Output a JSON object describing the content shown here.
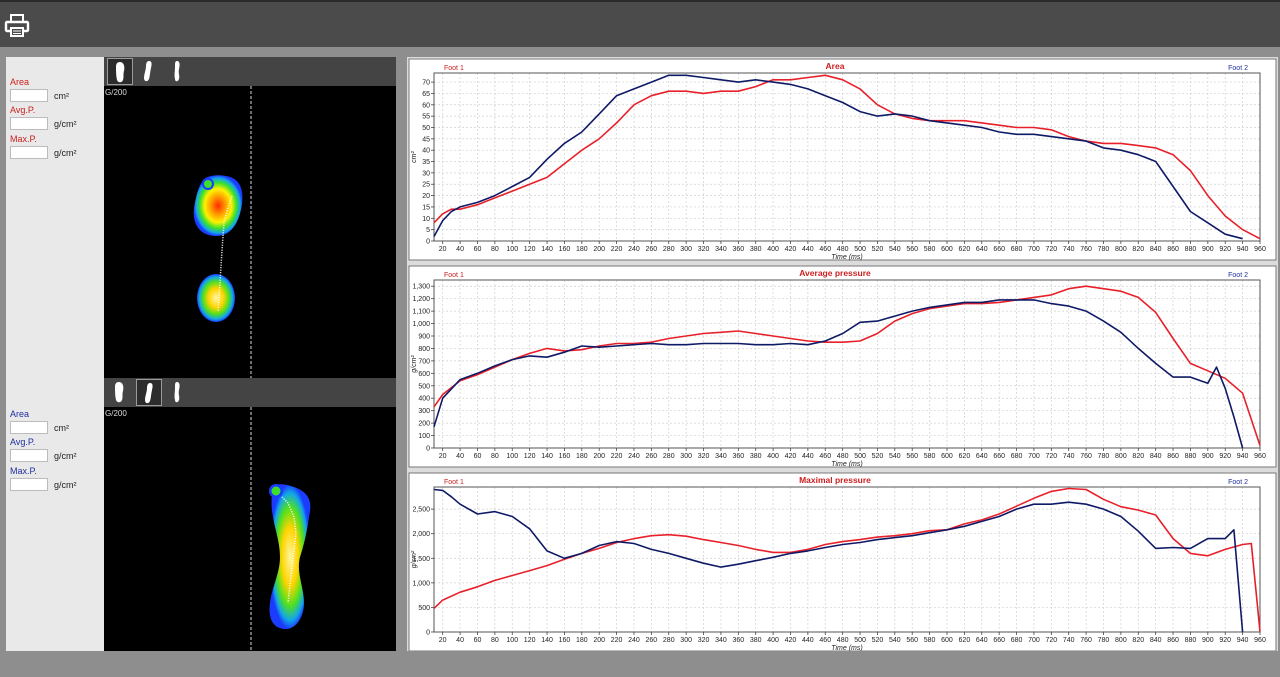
{
  "left_panel": {
    "foot1": {
      "color": "#cc2020",
      "fields": [
        {
          "label": "Area",
          "unit": "cm²",
          "value": ""
        },
        {
          "label": "Avg.P.",
          "unit": "g/cm²",
          "value": ""
        },
        {
          "label": "Max.P.",
          "unit": "g/cm²",
          "value": ""
        }
      ]
    },
    "foot2": {
      "color": "#1f2fa0",
      "fields": [
        {
          "label": "Area",
          "unit": "cm²",
          "value": ""
        },
        {
          "label": "Avg.P.",
          "unit": "g/cm²",
          "value": ""
        },
        {
          "label": "Max.P.",
          "unit": "g/cm²",
          "value": ""
        }
      ]
    }
  },
  "foot_views": [
    {
      "scale_label": "G/200",
      "active_button": 0
    },
    {
      "scale_label": "G/200",
      "active_button": 1
    }
  ],
  "icons": [
    "printer-icon",
    "foot-left-icon",
    "foot-right-icon",
    "foot-both-icon"
  ],
  "colors": {
    "foot1": "#e8202a",
    "foot2": "#0f1a66",
    "foot1_label": "#cc2020",
    "foot2_label": "#1f2fa0"
  },
  "chart_data": [
    {
      "type": "line",
      "title": "Area",
      "xlabel": "Time (ms)",
      "ylabel": "cm²",
      "legend_left": "Foot 1",
      "legend_right": "Foot 2",
      "xlim": [
        10,
        960
      ],
      "ylim": [
        0,
        74
      ],
      "xticks": [
        20,
        40,
        60,
        80,
        100,
        120,
        140,
        160,
        180,
        200,
        220,
        240,
        260,
        280,
        300,
        320,
        340,
        360,
        380,
        400,
        420,
        440,
        460,
        480,
        500,
        520,
        540,
        560,
        580,
        600,
        620,
        640,
        660,
        680,
        700,
        720,
        740,
        760,
        780,
        800,
        820,
        840,
        860,
        880,
        900,
        920,
        940,
        960
      ],
      "yticks": [
        0,
        5,
        10,
        15,
        20,
        25,
        30,
        35,
        40,
        45,
        50,
        55,
        60,
        65,
        70
      ],
      "grid": true,
      "series": [
        {
          "name": "Foot 1",
          "color": "#e8202a",
          "x": [
            10,
            20,
            30,
            40,
            60,
            80,
            100,
            120,
            140,
            160,
            180,
            200,
            220,
            240,
            260,
            280,
            300,
            320,
            340,
            360,
            380,
            400,
            420,
            440,
            460,
            480,
            500,
            520,
            540,
            560,
            580,
            600,
            620,
            640,
            660,
            680,
            700,
            720,
            740,
            760,
            780,
            800,
            820,
            840,
            860,
            880,
            900,
            920,
            940,
            960
          ],
          "y": [
            8,
            12,
            14,
            14,
            16,
            19,
            22,
            25,
            28,
            34,
            40,
            45,
            52,
            60,
            64,
            66,
            66,
            65,
            66,
            66,
            68,
            71,
            71,
            72,
            73,
            71,
            67,
            60,
            56,
            54,
            53,
            53,
            53,
            52,
            51,
            50,
            50,
            49,
            46,
            44,
            43,
            43,
            42,
            41,
            38,
            31,
            20,
            11,
            5,
            1
          ]
        },
        {
          "name": "Foot 2",
          "color": "#0f1a66",
          "x": [
            10,
            20,
            30,
            40,
            60,
            80,
            100,
            120,
            140,
            160,
            180,
            200,
            220,
            240,
            260,
            280,
            300,
            320,
            340,
            360,
            380,
            400,
            420,
            440,
            460,
            480,
            500,
            520,
            540,
            560,
            580,
            600,
            620,
            640,
            660,
            680,
            700,
            720,
            740,
            760,
            780,
            800,
            820,
            840,
            860,
            880,
            900,
            920,
            940
          ],
          "y": [
            2,
            9,
            13,
            15,
            17,
            20,
            24,
            28,
            36,
            43,
            48,
            56,
            64,
            67,
            70,
            73,
            73,
            72,
            71,
            70,
            71,
            70,
            69,
            67,
            64,
            61,
            57,
            55,
            56,
            55,
            53,
            52,
            51,
            50,
            48,
            47,
            47,
            46,
            45,
            44,
            41,
            40,
            38,
            35,
            24,
            13,
            8,
            3,
            1
          ]
        }
      ]
    },
    {
      "type": "line",
      "title": "Average pressure",
      "xlabel": "Time (ms)",
      "ylabel": "g/cm²",
      "legend_left": "Foot 1",
      "legend_right": "Foot 2",
      "xlim": [
        10,
        960
      ],
      "ylim": [
        0,
        1350
      ],
      "xticks": [
        20,
        40,
        60,
        80,
        100,
        120,
        140,
        160,
        180,
        200,
        220,
        240,
        260,
        280,
        300,
        320,
        340,
        360,
        380,
        400,
        420,
        440,
        460,
        480,
        500,
        520,
        540,
        560,
        580,
        600,
        620,
        640,
        660,
        680,
        700,
        720,
        740,
        760,
        780,
        800,
        820,
        840,
        860,
        880,
        900,
        920,
        940,
        960
      ],
      "yticks": [
        0,
        100,
        200,
        300,
        400,
        500,
        600,
        700,
        800,
        900,
        1000,
        1100,
        1200,
        1300
      ],
      "ytick_labels": [
        "0",
        "100",
        "200",
        "300",
        "400",
        "500",
        "600",
        "700",
        "800",
        "900",
        "1,000",
        "1,100",
        "1,200",
        "1,300"
      ],
      "grid": true,
      "series": [
        {
          "name": "Foot 1",
          "color": "#e8202a",
          "x": [
            10,
            20,
            40,
            60,
            80,
            100,
            120,
            140,
            160,
            180,
            200,
            220,
            240,
            260,
            280,
            300,
            320,
            340,
            360,
            380,
            400,
            420,
            440,
            460,
            480,
            500,
            520,
            540,
            560,
            580,
            600,
            620,
            640,
            660,
            680,
            700,
            720,
            740,
            760,
            780,
            800,
            820,
            840,
            860,
            880,
            900,
            920,
            940,
            960
          ],
          "y": [
            330,
            430,
            540,
            590,
            650,
            710,
            760,
            800,
            780,
            790,
            820,
            840,
            840,
            850,
            880,
            900,
            920,
            930,
            940,
            920,
            900,
            880,
            860,
            850,
            850,
            860,
            920,
            1020,
            1080,
            1120,
            1140,
            1160,
            1160,
            1170,
            1190,
            1210,
            1230,
            1280,
            1300,
            1280,
            1260,
            1210,
            1090,
            880,
            680,
            620,
            560,
            440,
            20
          ]
        },
        {
          "name": "Foot 2",
          "color": "#0f1a66",
          "x": [
            10,
            20,
            40,
            60,
            80,
            100,
            120,
            140,
            160,
            180,
            200,
            220,
            240,
            260,
            280,
            300,
            320,
            340,
            360,
            380,
            400,
            420,
            440,
            460,
            480,
            500,
            520,
            540,
            560,
            580,
            600,
            620,
            640,
            660,
            680,
            700,
            720,
            740,
            760,
            780,
            800,
            820,
            840,
            860,
            880,
            900,
            910,
            920,
            930,
            940
          ],
          "y": [
            170,
            400,
            550,
            600,
            660,
            710,
            740,
            730,
            770,
            820,
            810,
            820,
            830,
            840,
            830,
            830,
            840,
            840,
            840,
            830,
            830,
            840,
            830,
            860,
            920,
            1010,
            1020,
            1060,
            1100,
            1130,
            1150,
            1170,
            1170,
            1190,
            1190,
            1190,
            1160,
            1140,
            1100,
            1020,
            930,
            800,
            680,
            570,
            570,
            520,
            650,
            480,
            250,
            0
          ]
        }
      ]
    },
    {
      "type": "line",
      "title": "Maximal pressure",
      "xlabel": "Time (ms)",
      "ylabel": "g/cm²",
      "legend_left": "Foot 1",
      "legend_right": "Foot 2",
      "xlim": [
        10,
        960
      ],
      "ylim": [
        0,
        2950
      ],
      "xticks": [
        20,
        40,
        60,
        80,
        100,
        120,
        140,
        160,
        180,
        200,
        220,
        240,
        260,
        280,
        300,
        320,
        340,
        360,
        380,
        400,
        420,
        440,
        460,
        480,
        500,
        520,
        540,
        560,
        580,
        600,
        620,
        640,
        660,
        680,
        700,
        720,
        740,
        760,
        780,
        800,
        820,
        840,
        860,
        880,
        900,
        920,
        940,
        960
      ],
      "yticks": [
        0,
        500,
        1000,
        1500,
        2000,
        2500
      ],
      "ytick_labels": [
        "0",
        "500",
        "1,000",
        "1,500",
        "2,000",
        "2,500"
      ],
      "grid": true,
      "series": [
        {
          "name": "Foot 1",
          "color": "#e8202a",
          "x": [
            10,
            20,
            40,
            60,
            80,
            100,
            120,
            140,
            160,
            180,
            200,
            220,
            240,
            260,
            280,
            300,
            320,
            340,
            360,
            380,
            400,
            420,
            440,
            460,
            480,
            500,
            520,
            540,
            560,
            580,
            600,
            620,
            640,
            660,
            680,
            700,
            720,
            740,
            760,
            780,
            800,
            820,
            840,
            860,
            880,
            900,
            920,
            940,
            950,
            960
          ],
          "y": [
            480,
            650,
            810,
            920,
            1050,
            1150,
            1250,
            1350,
            1480,
            1600,
            1700,
            1820,
            1900,
            1960,
            1980,
            1950,
            1880,
            1820,
            1760,
            1680,
            1620,
            1620,
            1680,
            1780,
            1840,
            1880,
            1930,
            1960,
            2000,
            2060,
            2080,
            2200,
            2280,
            2400,
            2560,
            2720,
            2860,
            2920,
            2900,
            2700,
            2550,
            2480,
            2380,
            1900,
            1600,
            1550,
            1680,
            1780,
            1800,
            10
          ]
        },
        {
          "name": "Foot 2",
          "color": "#0f1a66",
          "x": [
            10,
            20,
            30,
            40,
            60,
            80,
            100,
            120,
            140,
            160,
            180,
            200,
            220,
            240,
            260,
            280,
            300,
            320,
            340,
            360,
            380,
            400,
            420,
            440,
            460,
            480,
            500,
            520,
            540,
            560,
            580,
            600,
            620,
            640,
            660,
            680,
            700,
            720,
            740,
            760,
            780,
            800,
            820,
            840,
            860,
            880,
            900,
            920,
            930,
            940
          ],
          "y": [
            2900,
            2880,
            2750,
            2600,
            2400,
            2450,
            2350,
            2100,
            1650,
            1500,
            1600,
            1760,
            1840,
            1800,
            1680,
            1600,
            1500,
            1400,
            1320,
            1380,
            1450,
            1520,
            1600,
            1650,
            1720,
            1780,
            1820,
            1880,
            1920,
            1960,
            2020,
            2080,
            2150,
            2250,
            2350,
            2500,
            2600,
            2600,
            2640,
            2600,
            2500,
            2350,
            2050,
            1700,
            1720,
            1700,
            1900,
            1900,
            2080,
            0
          ]
        }
      ]
    }
  ]
}
